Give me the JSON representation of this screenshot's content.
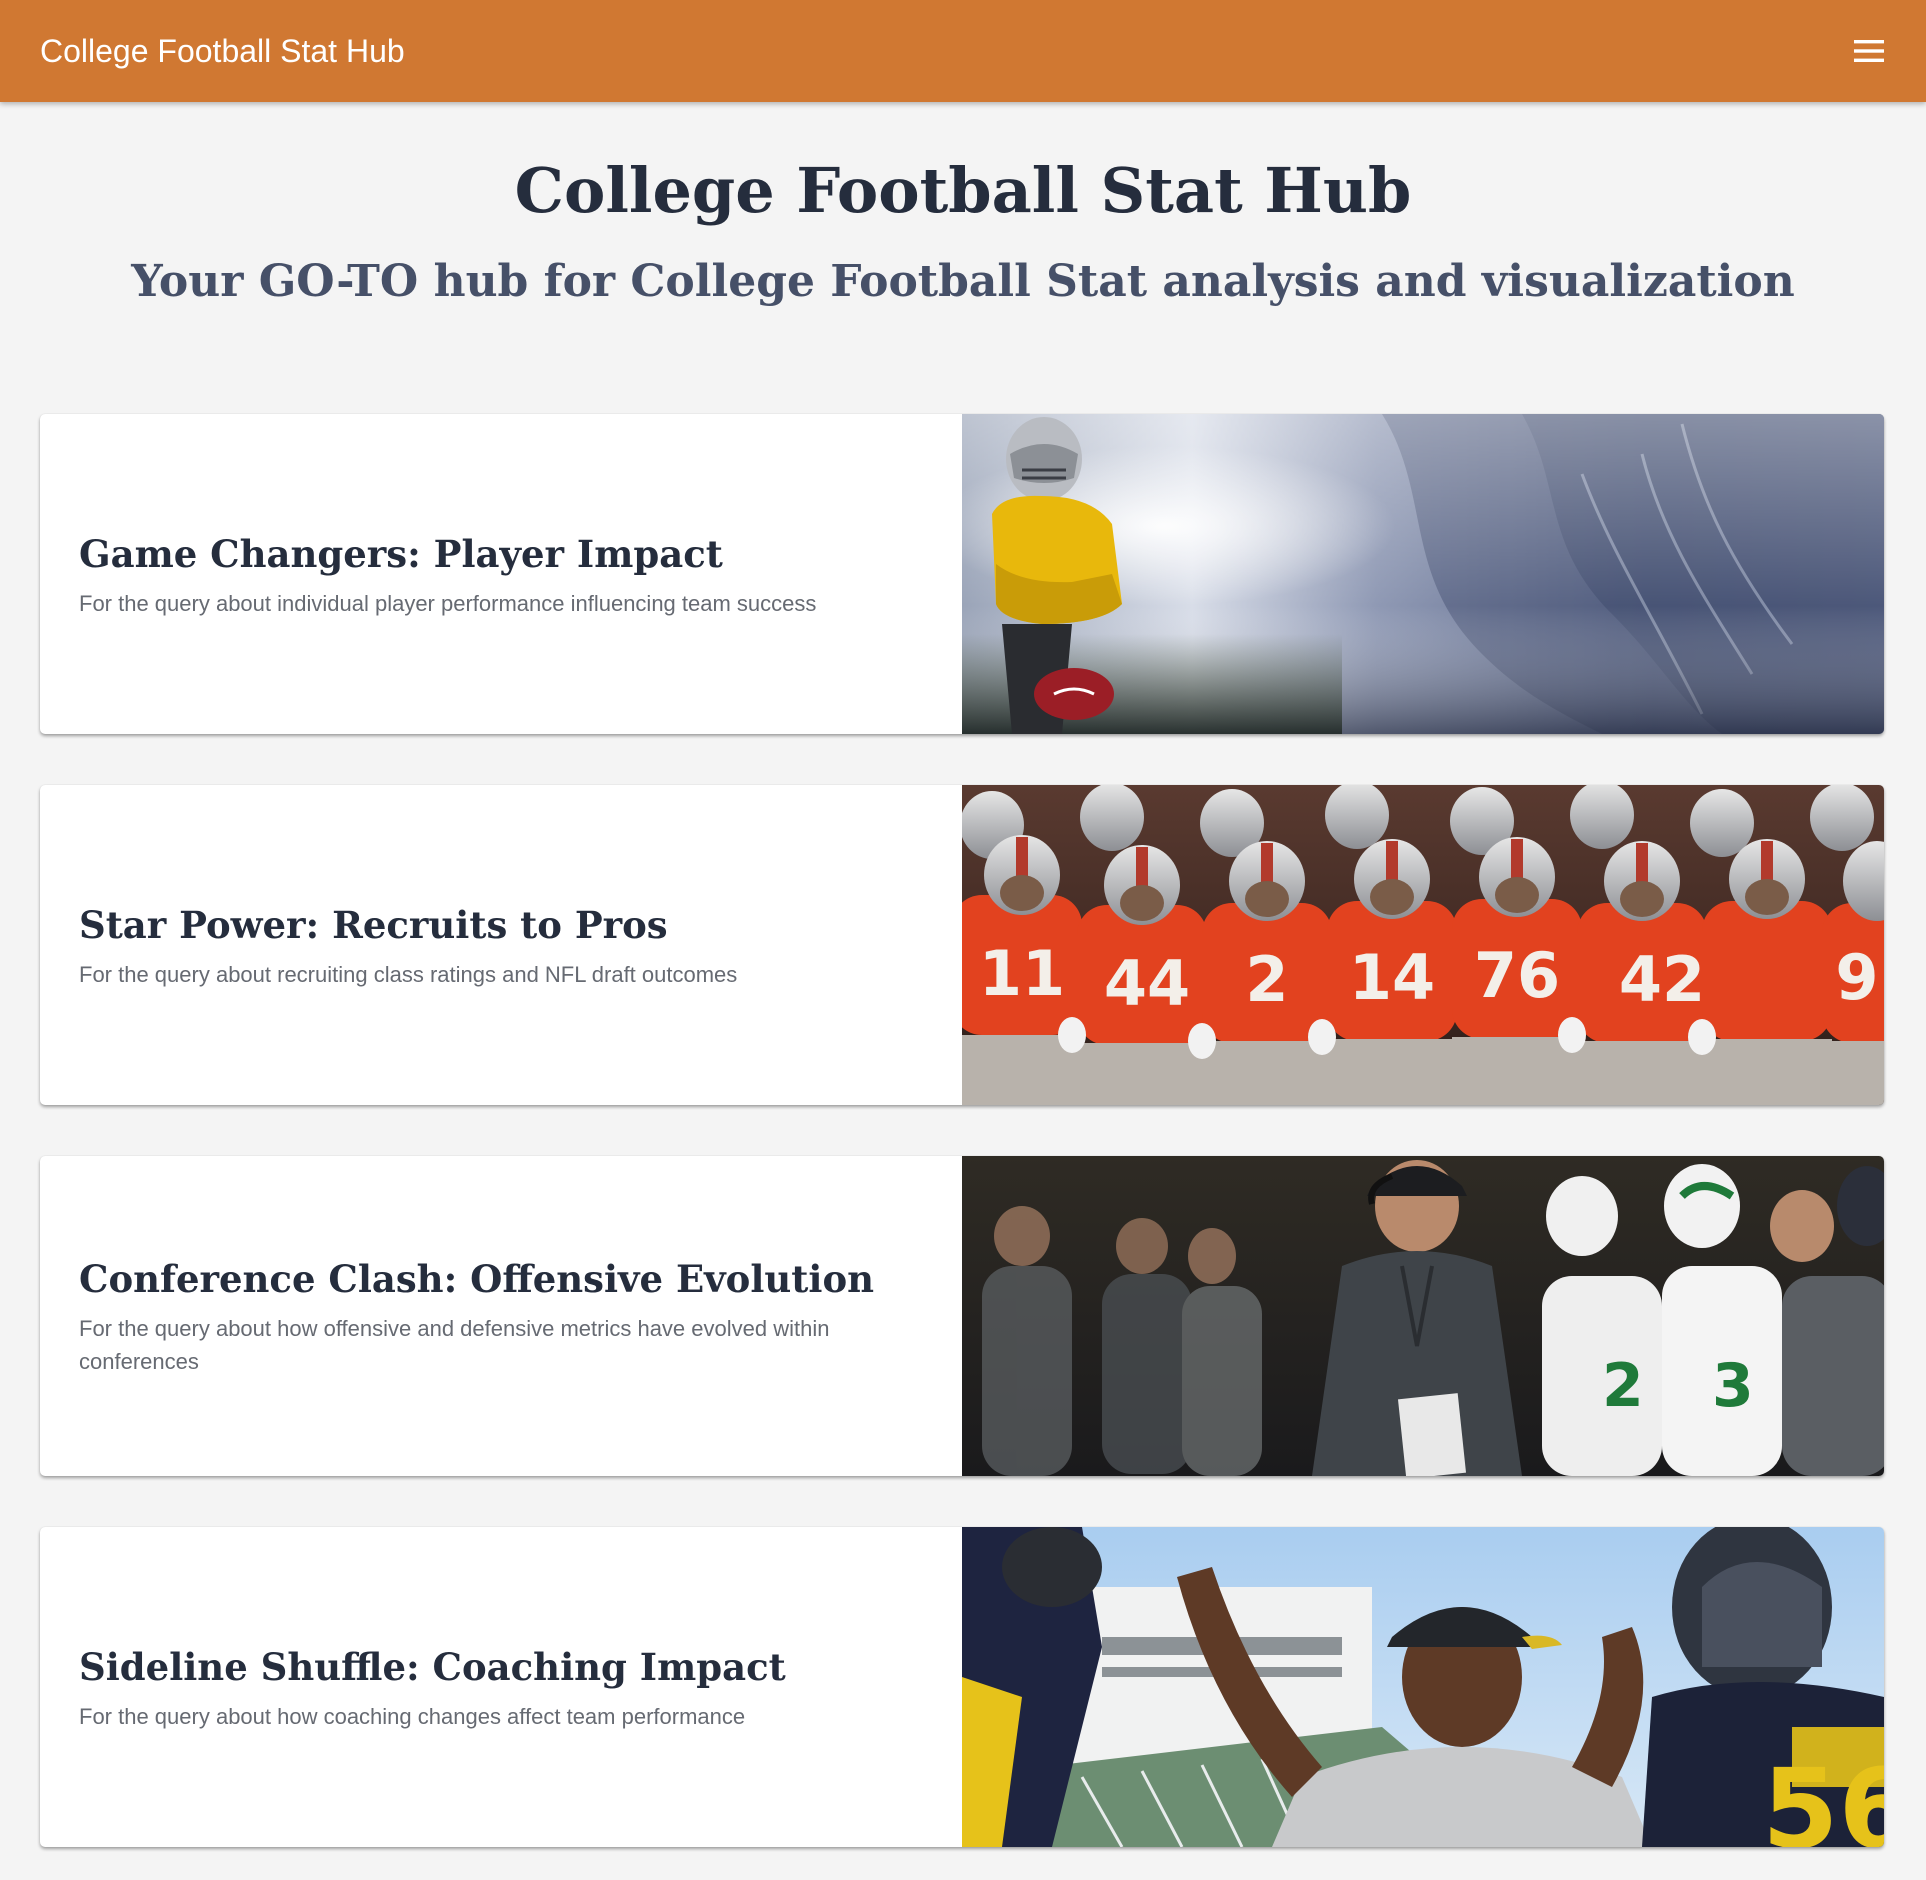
{
  "appbar": {
    "title": "College Football Stat Hub",
    "menu_icon": "hamburger-menu-icon",
    "color": "#d07832"
  },
  "hero": {
    "title": "College Football Stat Hub",
    "subtitle": "Your GO-TO hub for College Football Stat analysis and visualization"
  },
  "cards": [
    {
      "title": "Game Changers: Player Impact",
      "description": "For the query about individual player performance influencing team success",
      "image": "player-in-yellow-jersey-holding-football-photo"
    },
    {
      "title": "Star Power: Recruits to Pros",
      "description": "For the query about recruiting class ratings and NFL draft outcomes",
      "image": "team-in-red-jerseys-lined-up-photo",
      "jersey_numbers": [
        "11",
        "44",
        "2",
        "14",
        "76",
        "42",
        "9"
      ]
    },
    {
      "title": "Conference Clash: Offensive Evolution",
      "description": "For the query about how offensive and defensive metrics have evolved within conferences",
      "image": "coach-with-headset-on-sideline-photo"
    },
    {
      "title": "Sideline Shuffle: Coaching Impact",
      "description": "For the query about how coaching changes affect team performance",
      "image": "coach-celebrating-with-players-photo"
    }
  ],
  "colors": {
    "background": "#f4f4f4",
    "heading": "#252d3d",
    "subheading": "#465068",
    "body_text": "#666a72"
  }
}
